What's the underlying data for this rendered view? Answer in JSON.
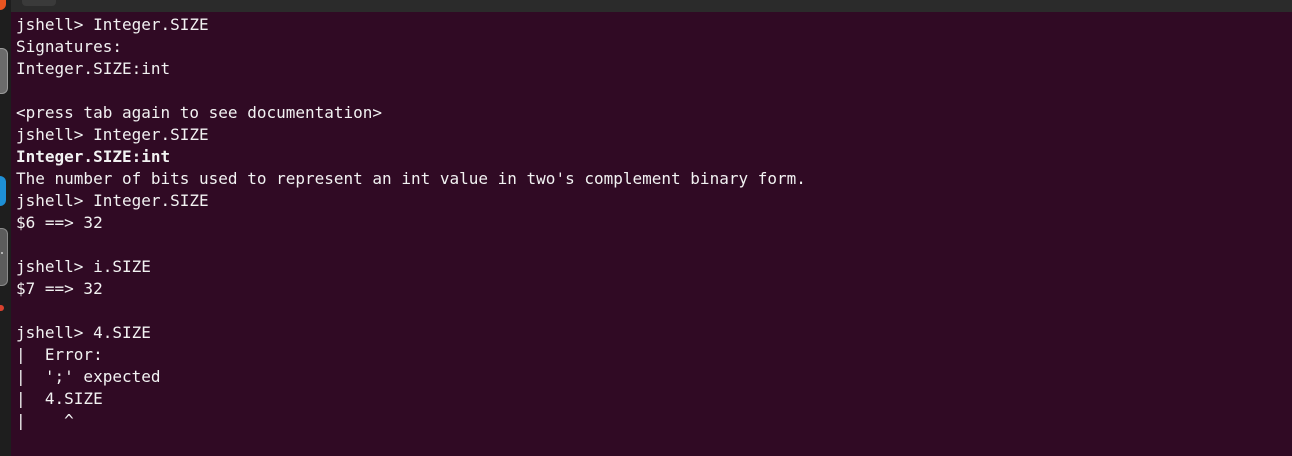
{
  "terminal": {
    "lines": [
      {
        "text": "jshell> Integer.SIZE",
        "bold": false
      },
      {
        "text": "Signatures:",
        "bold": false
      },
      {
        "text": "Integer.SIZE:int",
        "bold": false
      },
      {
        "text": "",
        "bold": false
      },
      {
        "text": "<press tab again to see documentation>",
        "bold": false
      },
      {
        "text": "jshell> Integer.SIZE",
        "bold": false
      },
      {
        "text": "Integer.SIZE:int",
        "bold": true
      },
      {
        "text": "The number of bits used to represent an int value in two's complement binary form.",
        "bold": false
      },
      {
        "text": "jshell> Integer.SIZE",
        "bold": false
      },
      {
        "text": "$6 ==> 32",
        "bold": false
      },
      {
        "text": "",
        "bold": false
      },
      {
        "text": "jshell> i.SIZE",
        "bold": false
      },
      {
        "text": "$7 ==> 32",
        "bold": false
      },
      {
        "text": "",
        "bold": false
      },
      {
        "text": "jshell> 4.SIZE",
        "bold": false
      },
      {
        "text": "|  Error:",
        "bold": false
      },
      {
        "text": "|  ';' expected",
        "bold": false
      },
      {
        "text": "|  4.SIZE",
        "bold": false
      },
      {
        "text": "|    ^",
        "bold": false
      }
    ]
  },
  "colors": {
    "background": "#300a24",
    "foreground": "#f2f2f2"
  }
}
